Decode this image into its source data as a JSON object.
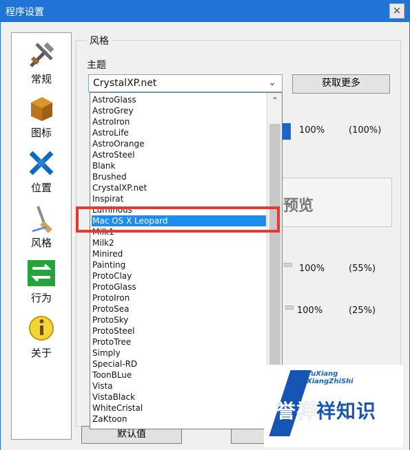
{
  "window": {
    "title": "程序设置",
    "close_label": "×"
  },
  "sidebar": {
    "items": [
      {
        "label": "常规",
        "icon": "tools-icon"
      },
      {
        "label": "图标",
        "icon": "box-icon"
      },
      {
        "label": "位置",
        "icon": "arrows-icon"
      },
      {
        "label": "风格",
        "icon": "brush-icon"
      },
      {
        "label": "行为",
        "icon": "exchange-icon"
      },
      {
        "label": "关于",
        "icon": "info-icon"
      }
    ]
  },
  "style_group": {
    "title": "风格",
    "theme_label": "主题",
    "theme_value": "CrystalXP.net",
    "get_more": "获取更多",
    "values": {
      "p1": "100%",
      "p1b": "(100%)",
      "p2": "100%",
      "p2b": "(55%)",
      "p3": "100%",
      "p3b": "(25%)"
    },
    "preview_text": "预览",
    "default_button": "默认值"
  },
  "dropdown": {
    "items": [
      "AstroGlass",
      "AstroGrey",
      "AstroIron",
      "AstroLife",
      "AstroOrange",
      "AstroSteel",
      "Blank",
      "Brushed",
      "CrystalXP.net",
      "Inspirat",
      "Luminous",
      "Mac OS X Leopard",
      "Milk1",
      "Milk2",
      "Minired",
      "Painting",
      "ProtoClay",
      "ProtoGlass",
      "ProtoIron",
      "ProtoSea",
      "ProtoSky",
      "ProtoSteel",
      "ProtoTree",
      "Simply",
      "Special-RD",
      "ToonBLue",
      "Vista",
      "VistaBlack",
      "WhiteCristal",
      "ZaKtoon"
    ],
    "selected_index": 11
  },
  "watermark": {
    "line1": "YuXiang",
    "line2": "XiangZhiShi",
    "text1": "誉祥",
    "text2": "祥知识"
  },
  "colors": {
    "titlebar": "#1f74d6",
    "selection": "#1e8df0",
    "highlight_box": "#e53935"
  }
}
